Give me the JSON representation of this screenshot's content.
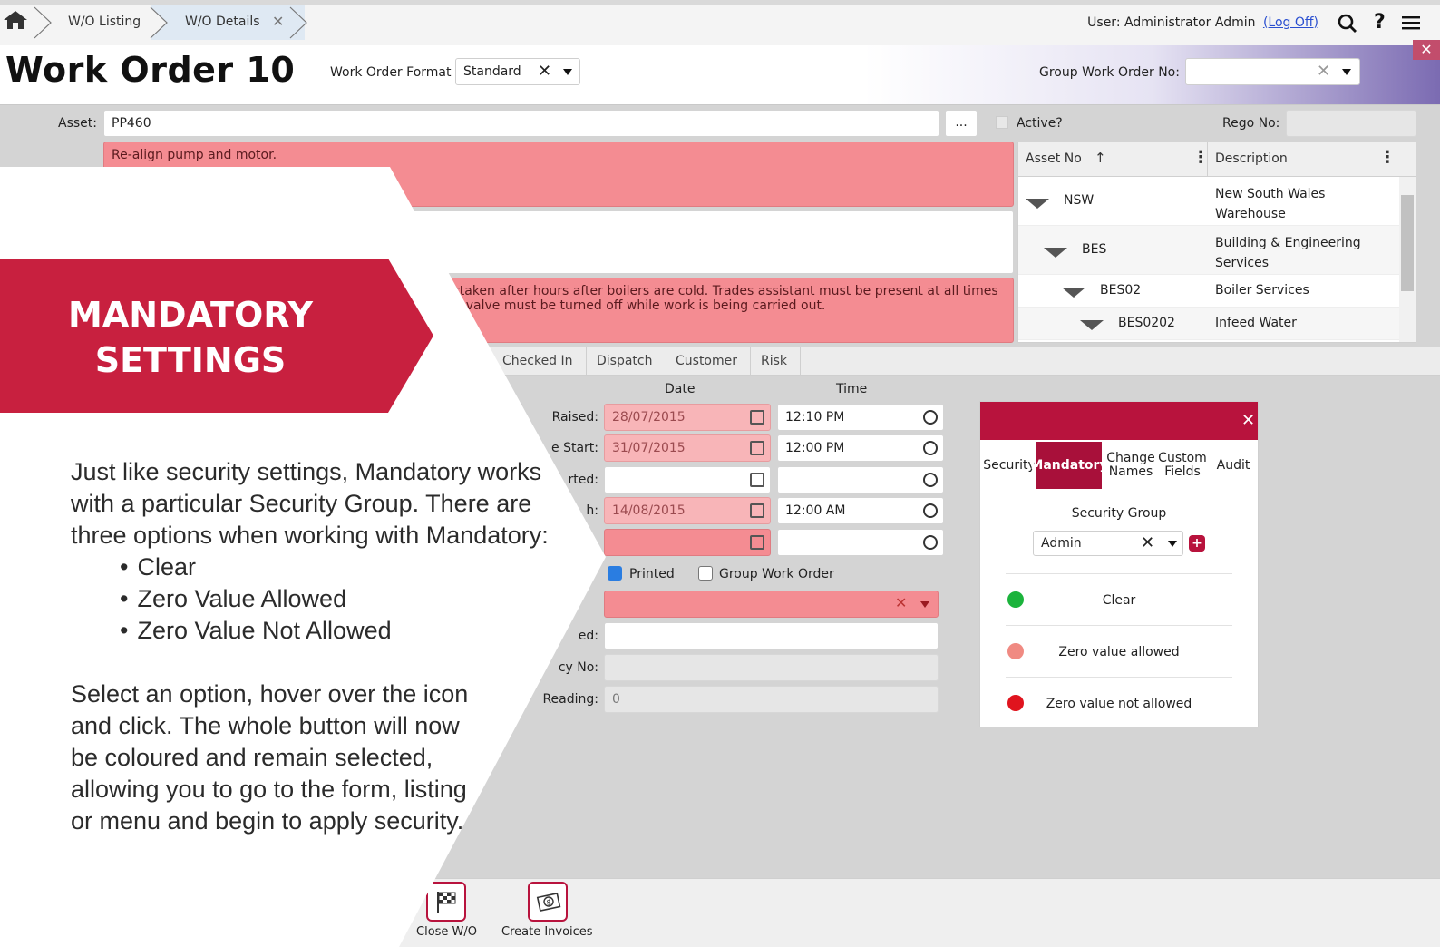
{
  "breadcrumbs": [
    "W/O Listing",
    "W/O Details"
  ],
  "user": {
    "label": "User: Administrator Admin",
    "logoff": "(Log Off)"
  },
  "header": {
    "title": "Work Order 10",
    "format_label": "Work Order Format",
    "format_value": "Standard",
    "group_label": "Group Work Order No:"
  },
  "form": {
    "asset_label": "Asset:",
    "asset_value": "PP460",
    "asset_btn": "...",
    "active_label": "Active?",
    "rego_label": "Rego No:",
    "description": "Re-align pump and motor.",
    "notes_line1": "rtaken after hours after boilers are cold.  Trades assistant must be present at all times",
    "notes_line2": "y valve must be turned off while work is being carried out."
  },
  "tree": {
    "col1": "Asset No",
    "col2": "Description",
    "rows": [
      {
        "no": "NSW",
        "desc1": "New South Wales",
        "desc2": "Warehouse"
      },
      {
        "no": "BES",
        "desc1": "Building & Engineering",
        "desc2": "Services"
      },
      {
        "no": "BES02",
        "desc1": "Boiler Services",
        "desc2": ""
      },
      {
        "no": "BES0202",
        "desc1": "Infeed Water",
        "desc2": ""
      }
    ]
  },
  "tabs": [
    "Checked In",
    "Dispatch",
    "Customer",
    "Risk"
  ],
  "dates": {
    "date_header": "Date",
    "time_header": "Time",
    "raised_label": "Raised:",
    "raised_date": "28/07/2015",
    "raised_time": "12:10 PM",
    "start_label": "e Start:",
    "start_date": "31/07/2015",
    "start_time": "12:00 PM",
    "started_label": "rted:",
    "finish_label": "h:",
    "finish_date": "14/08/2015",
    "finish_time": "12:00 AM",
    "printed_label": "Printed",
    "group_wo_label": "Group Work Order",
    "requested_label": "ed:",
    "policy_label": "cy No:",
    "reading_label": "Reading:",
    "reading_value": "0"
  },
  "panel": {
    "tabs": [
      "Security",
      "Mandatory",
      "Change Names",
      "Custom Fields",
      "Audit"
    ],
    "security_group_label": "Security Group",
    "security_group_value": "Admin",
    "options": [
      {
        "label": "Clear",
        "color": "#1bb33c"
      },
      {
        "label": "Zero value allowed",
        "color": "#f08a82"
      },
      {
        "label": "Zero value not allowed",
        "color": "#e0141e"
      }
    ]
  },
  "toolbar": {
    "close": "Close W/O",
    "invoices": "Create Invoices"
  },
  "overlay": {
    "title_line1": "MANDATORY",
    "title_line2": "SETTINGS",
    "para1": "Just like security settings, Mandatory works with a particular Security Group. There are three options when working with Mandatory:",
    "bullets": [
      "Clear",
      "Zero Value Allowed",
      "Zero Value Not Allowed"
    ],
    "para2": "Select an option, hover over the icon and click. The whole button will now be coloured and remain selected, allowing you to go to the form, listing or menu and begin to apply security."
  },
  "colors": {
    "accent": "#b8133d",
    "banner": "#c8203f",
    "mandatory_field": "#f48c92"
  }
}
